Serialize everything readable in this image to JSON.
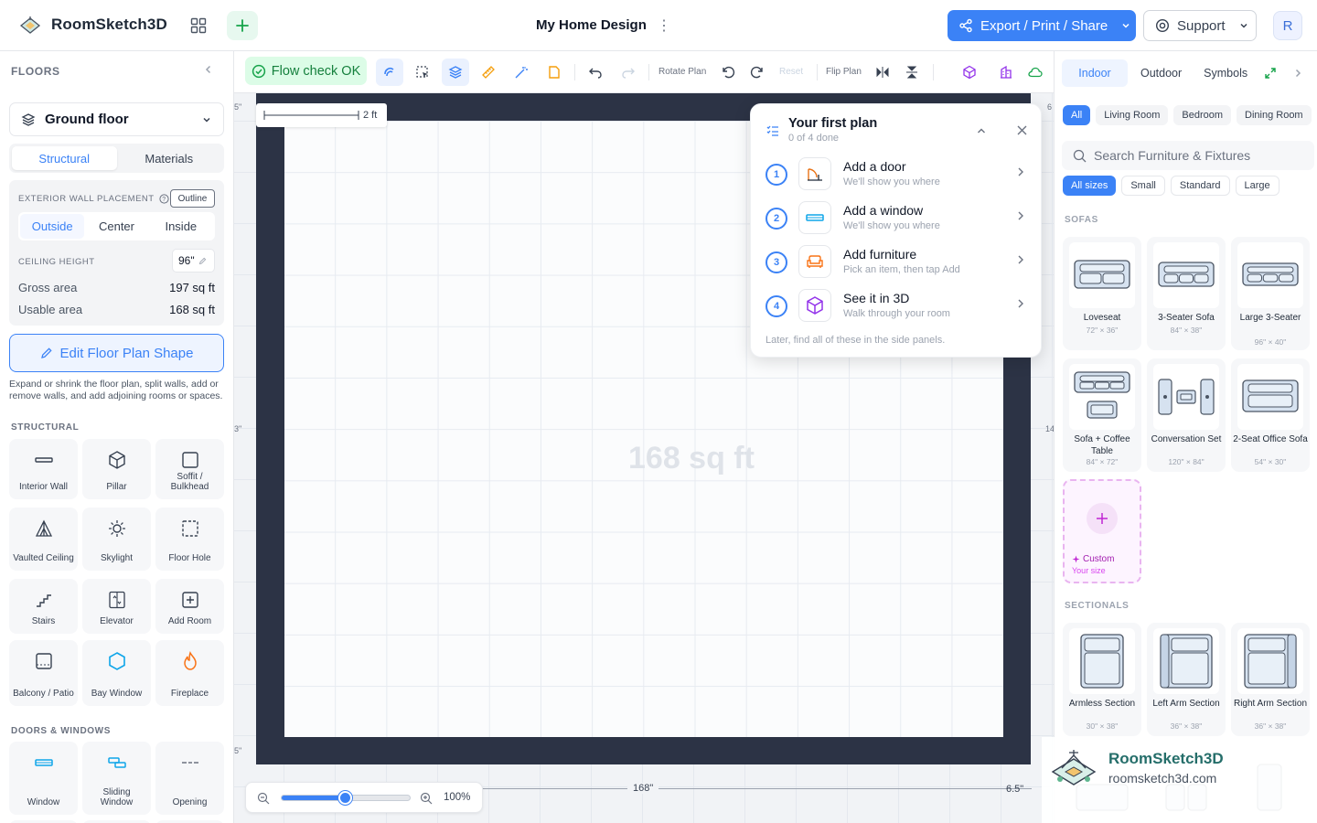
{
  "app": {
    "name": "RoomSketch3D",
    "doc_title": "My Home Design",
    "export_label": "Export / Print / Share",
    "support_label": "Support",
    "avatar_initial": "R",
    "accent": "#3b82f6"
  },
  "left": {
    "header": "FLOORS",
    "floor": "Ground floor",
    "tabs": [
      "Structural",
      "Materials"
    ],
    "wall": {
      "title": "EXTERIOR WALL PLACEMENT",
      "outline": "Outline",
      "options": [
        "Outside",
        "Center",
        "Inside"
      ],
      "ceiling_label": "CEILING HEIGHT",
      "ceiling_value": "96\"",
      "gross_label": "Gross area",
      "gross_value": "197 sq ft",
      "usable_label": "Usable area",
      "usable_value": "168 sq ft"
    },
    "edit_label": "Edit Floor Plan Shape",
    "edit_desc": "Expand or shrink the floor plan, split walls, add or remove walls, and add adjoining rooms or spaces.",
    "structural_header": "STRUCTURAL",
    "structural": [
      "Interior Wall",
      "Pillar",
      "Soffit / Bulkhead",
      "Vaulted Ceiling",
      "Skylight",
      "Floor Hole",
      "Stairs",
      "Elevator",
      "Add Room",
      "Balcony / Patio",
      "Bay Window",
      "Fireplace"
    ],
    "doors_header": "DOORS & WINDOWS",
    "doors": [
      "Window",
      "Sliding Window",
      "Opening"
    ]
  },
  "toolbar": {
    "flow_ok": "Flow check OK",
    "rotate": "Rotate Plan",
    "reset": "Reset",
    "flip": "Flip Plan"
  },
  "canvas": {
    "scale_label": "2 ft",
    "area_label": "168 sq ft",
    "dim_width": "168\"",
    "dim_right": "6.5\"",
    "zoom_pct": "100%",
    "zoom_level": 0.5,
    "edge_marks": {
      "left_top": "5\"",
      "left_mid": "3\"",
      "left_bot": "5\"",
      "right_top": "6",
      "right_mid": "14"
    }
  },
  "checklist": {
    "title": "Your first plan",
    "progress": "0 of 4 done",
    "items": [
      {
        "num": "1",
        "title": "Add a door",
        "desc": "We'll show you where"
      },
      {
        "num": "2",
        "title": "Add a window",
        "desc": "We'll show you where"
      },
      {
        "num": "3",
        "title": "Add furniture",
        "desc": "Pick an item, then tap Add"
      },
      {
        "num": "4",
        "title": "See it in 3D",
        "desc": "Walk through your room"
      }
    ],
    "footer": "Later, find all of these in the side panels."
  },
  "right": {
    "tabs": [
      "Indoor",
      "Outdoor",
      "Symbols"
    ],
    "rooms": [
      "All",
      "Living Room",
      "Bedroom",
      "Dining Room"
    ],
    "search_placeholder": "Search Furniture & Fixtures",
    "sizes": [
      "All sizes",
      "Small",
      "Standard",
      "Large"
    ],
    "sofas_header": "SOFAS",
    "sofas": [
      {
        "name": "Loveseat",
        "size": "72\" × 36\""
      },
      {
        "name": "3-Seater Sofa",
        "size": "84\" × 38\""
      },
      {
        "name": "Large 3-Seater",
        "size": "96\" × 40\""
      },
      {
        "name": "Sofa + Coffee Table",
        "size": "84\" × 72\""
      },
      {
        "name": "Conversation Set",
        "size": "120\" × 84\""
      },
      {
        "name": "2-Seat Office Sofa",
        "size": "54\" × 30\""
      }
    ],
    "custom": {
      "label": "Custom",
      "sub": "Your size"
    },
    "sectionals_header": "SECTIONALS",
    "sectionals": [
      {
        "name": "Armless Section",
        "size": "30\" × 38\""
      },
      {
        "name": "Left Arm Section",
        "size": "36\" × 38\""
      },
      {
        "name": "Right Arm Section",
        "size": "36\" × 38\""
      }
    ]
  },
  "badge": {
    "title": "RoomSketch3D",
    "url": "roomsketch3d.com"
  }
}
